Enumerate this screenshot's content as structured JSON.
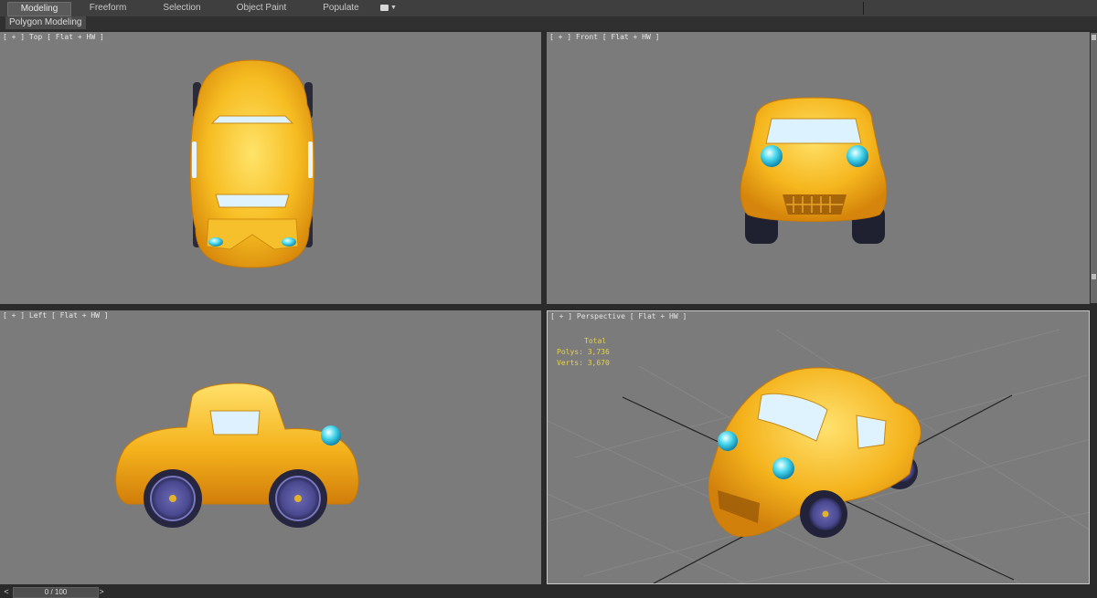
{
  "ribbon": {
    "tabs": [
      "Modeling",
      "Freeform",
      "Selection",
      "Object Paint",
      "Populate"
    ],
    "active_tab": "Modeling"
  },
  "subbar": {
    "label": "Polygon Modeling"
  },
  "viewports": {
    "top": {
      "label": "[ + ] Top [ Flat + HW ]"
    },
    "front": {
      "label": "[ + ] Front [ Flat + HW ]"
    },
    "left": {
      "label": "[ + ] Left [ Flat + HW ]"
    },
    "perspective": {
      "label": "[ + ] Perspective [ Flat + HW ]"
    }
  },
  "stats": {
    "title": "Total",
    "polys_label": "Polys:",
    "polys_value": "3,736",
    "verts_label": "Verts:",
    "verts_value": "3,670"
  },
  "timeline": {
    "frame": "0 / 100",
    "prev": "<",
    "next": ">"
  },
  "icons": {
    "viewport-options": "render-settings-icon"
  },
  "colors": {
    "car_body": "#f2b21d",
    "headlight": "#3fd3e8",
    "viewport_bg": "#7b7b7b"
  }
}
